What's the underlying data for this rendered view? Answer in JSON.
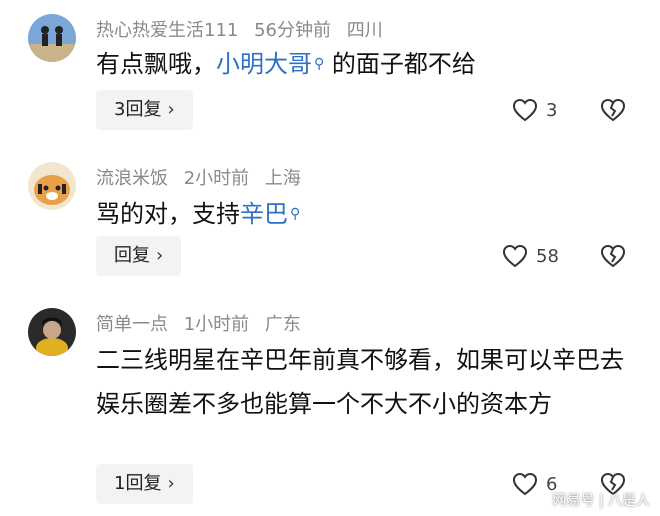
{
  "comments": [
    {
      "username": "热心热爱生活111",
      "time": "56分钟前",
      "location": "四川",
      "text_before": "有点飘哦，",
      "link": "小明大哥",
      "text_after": " 的面子都不给",
      "reply_label": "3回复",
      "likes": "3"
    },
    {
      "username": "流浪米饭",
      "time": "2小时前",
      "location": "上海",
      "text_before": "骂的对，支持",
      "link": "辛巴",
      "text_after": "",
      "reply_label": "回复",
      "likes": "58"
    },
    {
      "username": "简单一点",
      "time": "1小时前",
      "location": "广东",
      "text": "二三线明星在辛巴年前真不够看，如果可以辛巴去娱乐圈差不多也能算一个不大不小的资本方",
      "reply_label": "1回复",
      "likes": "6"
    }
  ],
  "watermark": "网易号 | 八是人",
  "colors": {
    "link": "#2f6fc4",
    "meta": "#8a8a8a",
    "reply_bg": "#f3f3f3"
  },
  "icons": [
    "search-icon",
    "chevron-right-icon",
    "heart-icon",
    "broken-heart-icon"
  ]
}
